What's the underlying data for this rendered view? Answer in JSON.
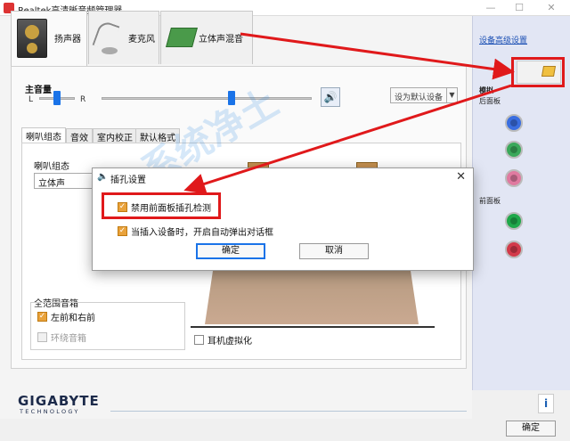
{
  "window": {
    "title": "Realtek高清晰音频管理器",
    "min": "—",
    "max": "☐",
    "close": "✕"
  },
  "device_tabs": [
    {
      "label": "扬声器"
    },
    {
      "label": "麦克风"
    },
    {
      "label": "立体声混音"
    }
  ],
  "volume": {
    "label": "主音量",
    "left": "L",
    "right": "R",
    "balance_level": 0.5,
    "volume_level": 0.62
  },
  "default_device": {
    "value": "设为默认设备"
  },
  "sub_tabs": [
    {
      "label": "喇叭组态"
    },
    {
      "label": "音效"
    },
    {
      "label": "室内校正"
    },
    {
      "label": "默认格式"
    }
  ],
  "speaker_config": {
    "label": "喇叭组态",
    "value": "立体声"
  },
  "fullrange": {
    "label": "全范围音箱",
    "front_lr": "左前和右前",
    "surround": "环绕音箱"
  },
  "headphone_virtualization": "耳机虚拟化",
  "right_panel": {
    "advanced_link": "设备高级设置",
    "analog": "模拟",
    "back_panel": "后面板",
    "front_panel": "前面板",
    "jack_colors": [
      "#3a6ee0",
      "#3aa85a",
      "#e07aa0",
      "#1fa84a",
      "#d23a4a"
    ]
  },
  "brand": {
    "name": "GIGABYTE",
    "sub": "TECHNOLOGY"
  },
  "ok_label": "确定",
  "watermark": "系统净土",
  "dialog": {
    "title": "插孔设置",
    "close": "✕",
    "option1": "禁用前面板插孔检测",
    "option2": "当插入设备时，开启自动弹出对话框",
    "ok": "确定",
    "cancel": "取消"
  }
}
